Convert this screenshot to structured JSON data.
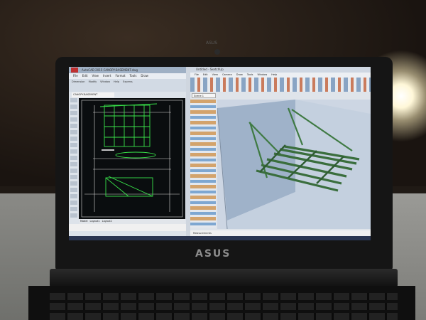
{
  "scene": {
    "laptop_brand": "ASUS",
    "top_brand": "ASUS"
  },
  "autocad": {
    "title": "AutoCAD 2015 CANOPY-BASEMENT.dwg",
    "menu": [
      "File",
      "Edit",
      "View",
      "Insert",
      "Format",
      "Tools",
      "Draw"
    ],
    "ribbon_groups": [
      "Dimension",
      "Modify",
      "Window",
      "Help",
      "Express"
    ],
    "file_tab": "CANOPY-BASEMENT",
    "layout_tabs": [
      "Model",
      "Layout1",
      "Layout2"
    ]
  },
  "sketchup": {
    "title": "Untitled - SketchUp",
    "menu": [
      "File",
      "Edit",
      "View",
      "Camera",
      "Draw",
      "Tools",
      "Window",
      "Help"
    ],
    "scene_tab": "Scene 1",
    "status": "Measurements"
  },
  "colors": {
    "cad_linework": "#39e34a",
    "model_frame": "#3f7a43",
    "viewport_wall": "#9fb2c9",
    "lamp": "#fff7d8"
  }
}
